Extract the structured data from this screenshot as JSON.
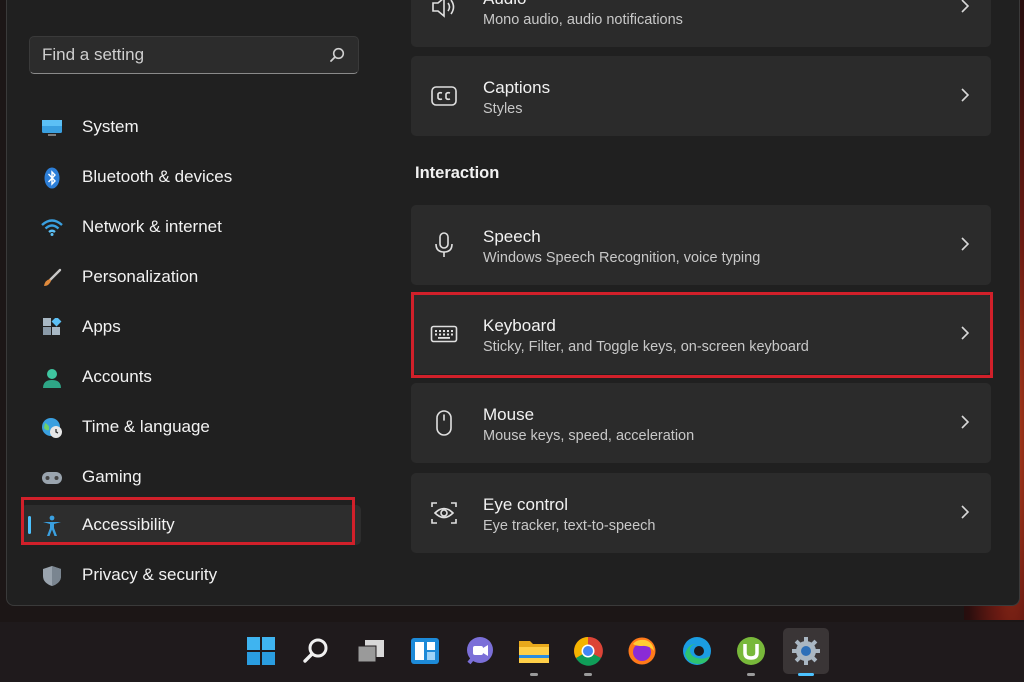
{
  "sidebar": {
    "search": {
      "placeholder": "Find a setting",
      "value": ""
    },
    "items": [
      {
        "label": "System",
        "icon": "monitor-icon"
      },
      {
        "label": "Bluetooth & devices",
        "icon": "bluetooth-icon"
      },
      {
        "label": "Network & internet",
        "icon": "wifi-icon"
      },
      {
        "label": "Personalization",
        "icon": "brush-icon"
      },
      {
        "label": "Apps",
        "icon": "apps-icon"
      },
      {
        "label": "Accounts",
        "icon": "person-icon"
      },
      {
        "label": "Time & language",
        "icon": "globe-clock-icon"
      },
      {
        "label": "Gaming",
        "icon": "gamepad-icon"
      },
      {
        "label": "Accessibility",
        "icon": "accessibility-icon",
        "selected": true
      },
      {
        "label": "Privacy & security",
        "icon": "shield-icon"
      }
    ]
  },
  "main": {
    "vision_cards": [
      {
        "title": "Audio",
        "subtitle": "Mono audio, audio notifications",
        "icon": "speaker-icon"
      },
      {
        "title": "Captions",
        "subtitle": "Styles",
        "icon": "captions-icon"
      }
    ],
    "interaction_section": {
      "title": "Interaction"
    },
    "interaction_cards": [
      {
        "title": "Speech",
        "subtitle": "Windows Speech Recognition, voice typing",
        "icon": "microphone-icon"
      },
      {
        "title": "Keyboard",
        "subtitle": "Sticky, Filter, and Toggle keys, on-screen keyboard",
        "icon": "keyboard-icon",
        "highlighted": true
      },
      {
        "title": "Mouse",
        "subtitle": "Mouse keys, speed, acceleration",
        "icon": "mouse-icon"
      },
      {
        "title": "Eye control",
        "subtitle": "Eye tracker, text-to-speech",
        "icon": "eye-control-icon"
      }
    ]
  },
  "taskbar": {
    "items": [
      {
        "name": "start-icon"
      },
      {
        "name": "search-icon"
      },
      {
        "name": "task-view-icon"
      },
      {
        "name": "widgets-icon"
      },
      {
        "name": "chat-icon"
      },
      {
        "name": "file-explorer-icon"
      },
      {
        "name": "chrome-icon"
      },
      {
        "name": "firefox-icon"
      },
      {
        "name": "edge-icon"
      },
      {
        "name": "utorrent-icon"
      },
      {
        "name": "settings-icon",
        "active": true
      }
    ]
  },
  "colors": {
    "accent": "#4cc2ff",
    "highlight_box": "#d1202a",
    "window_bg": "#202020",
    "card_bg": "#2b2b2b"
  }
}
